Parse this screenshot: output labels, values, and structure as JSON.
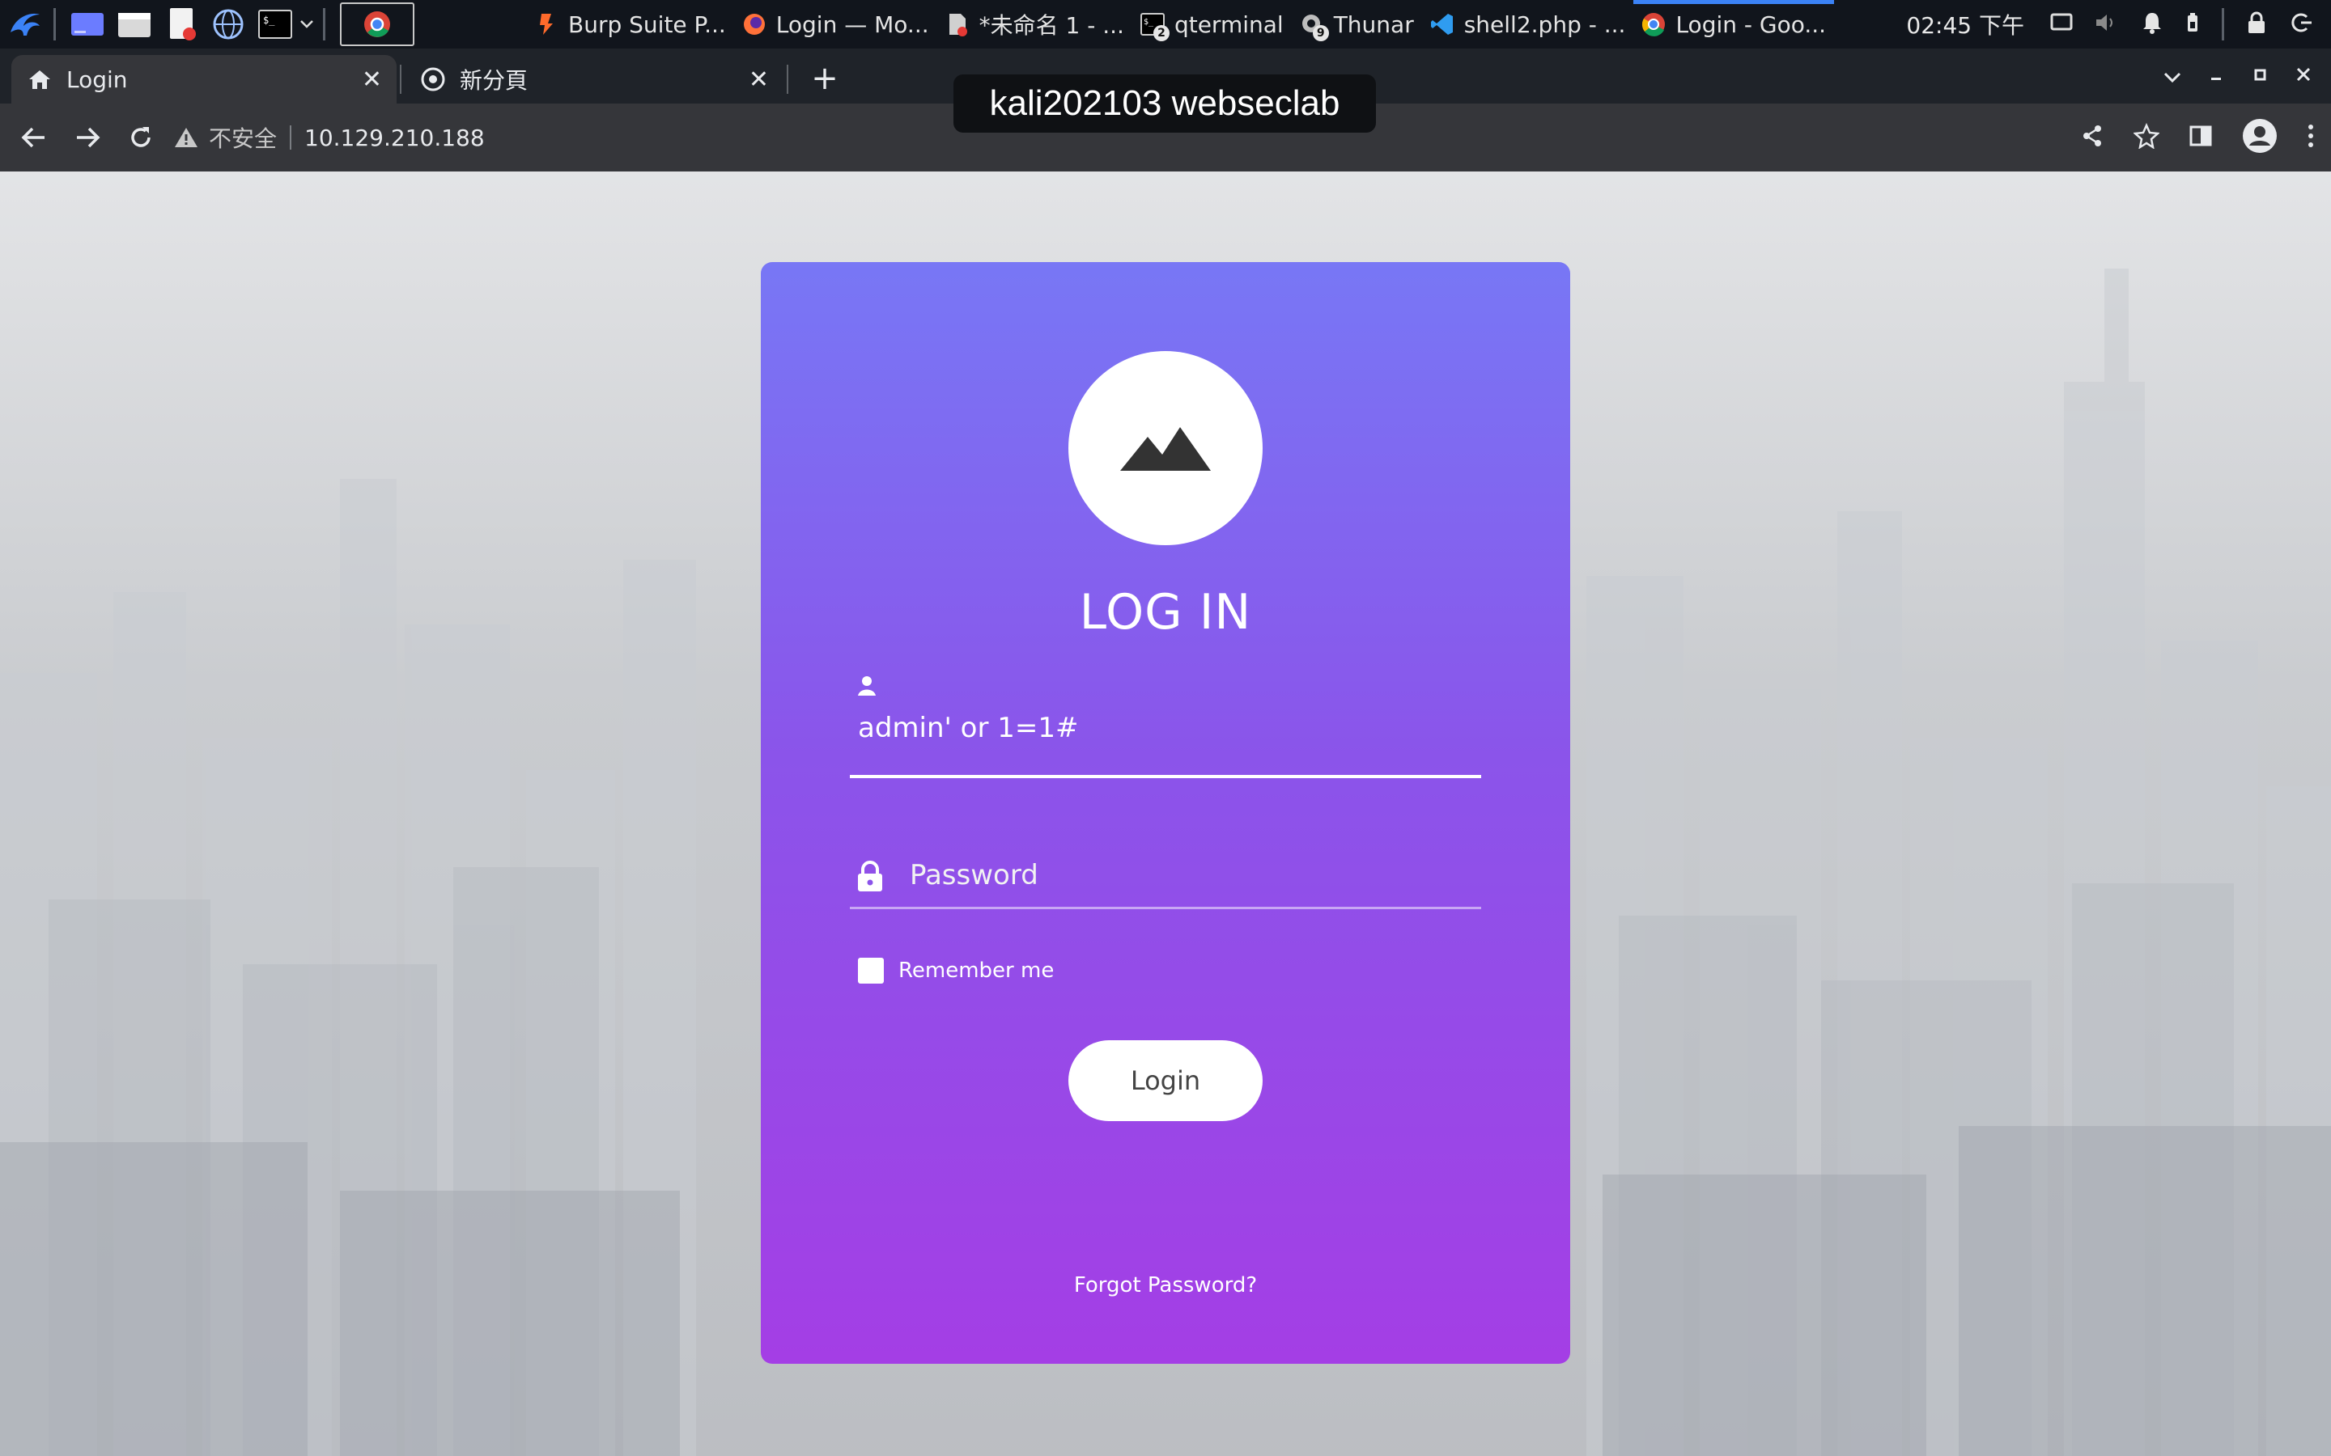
{
  "panel": {
    "tasks": [
      {
        "label": "Burp Suite P...",
        "icon": "burp-icon"
      },
      {
        "label": "Login — Mo...",
        "icon": "firefox-icon"
      },
      {
        "label": "*未命名 1 - ...",
        "icon": "document-icon"
      },
      {
        "label": "qterminal",
        "icon": "terminal-icon",
        "badge": "2"
      },
      {
        "label": "Thunar",
        "icon": "file-manager-icon",
        "badge": "9"
      },
      {
        "label": "shell2.php - ...",
        "icon": "vscode-icon"
      },
      {
        "label": "Login - Goo...",
        "icon": "chrome-icon",
        "active": true
      }
    ],
    "clock": "02:45 下午"
  },
  "browser": {
    "tabs": [
      {
        "title": "Login",
        "icon": "home-icon",
        "active": true
      },
      {
        "title": "新分頁",
        "icon": "chrome-icon",
        "active": false
      }
    ],
    "overlay_label": "kali202103 webseclab",
    "security_label": "不安全",
    "url": "10.129.210.188"
  },
  "login": {
    "title": "LOG IN",
    "username_value": "admin' or 1=1#",
    "password_placeholder": "Password",
    "remember_label": "Remember me",
    "login_button": "Login",
    "forgot_link": "Forgot Password?"
  },
  "colors": {
    "card_top": "#7877f5",
    "card_bottom": "#a43ee5",
    "panel_bg": "#11151c",
    "toolbar_bg": "#35363a"
  }
}
